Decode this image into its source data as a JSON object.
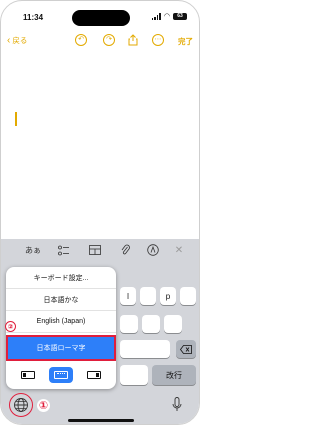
{
  "status_bar": {
    "time": "11:34",
    "battery": "63"
  },
  "nav_bar": {
    "back_label": "戻る",
    "done_label": "完了"
  },
  "accessory_bar": {
    "aa_label": "あぁ"
  },
  "language_menu": {
    "items": [
      {
        "label": "キーボード設定..."
      },
      {
        "label": "日本語かな"
      },
      {
        "label": "English (Japan)"
      },
      {
        "label": "日本語ローマ字",
        "selected": true
      }
    ],
    "modes": [
      "left-handed",
      "full-width",
      "right-handed"
    ],
    "active_mode": "full-width"
  },
  "keyboard": {
    "visible_keys": [
      "l",
      "p"
    ],
    "return_label": "改行"
  },
  "annotations": {
    "step1": "①",
    "step2": "②"
  },
  "colors": {
    "accent": "#e3aa00",
    "highlight": "#2d7ff9",
    "annotation_red": "#e01e3c",
    "keyboard_bg": "#d3d5da"
  }
}
